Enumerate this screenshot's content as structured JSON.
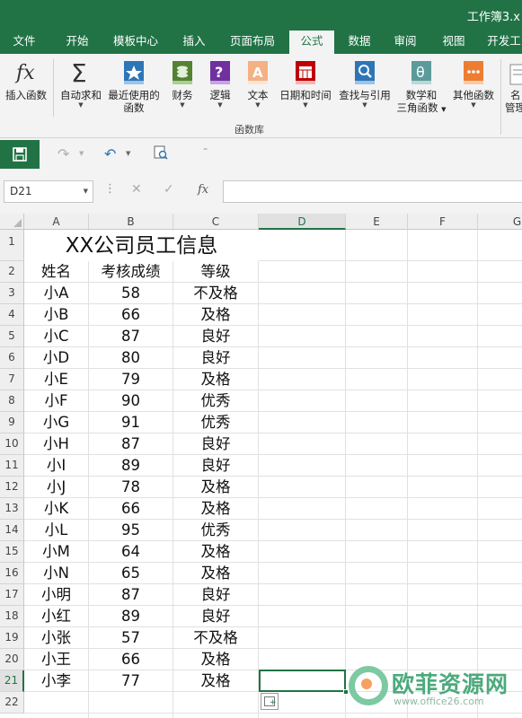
{
  "window": {
    "title": "工作簿3.x"
  },
  "tabs": [
    {
      "label": "文件"
    },
    {
      "label": "开始"
    },
    {
      "label": "模板中心"
    },
    {
      "label": "插入"
    },
    {
      "label": "页面布局"
    },
    {
      "label": "公式"
    },
    {
      "label": "数据"
    },
    {
      "label": "审阅"
    },
    {
      "label": "视图"
    },
    {
      "label": "开发工"
    }
  ],
  "active_tab": "公式",
  "ribbon": {
    "group_label": "函数库",
    "buttons": [
      {
        "line1": "插入函数",
        "line2": "",
        "icon": "fx-icon"
      },
      {
        "line1": "自动求和",
        "line2": "",
        "icon": "sigma-icon"
      },
      {
        "line1": "最近使用的",
        "line2": "函数",
        "icon": "star-book-icon"
      },
      {
        "line1": "财务",
        "line2": "",
        "icon": "coins-book-icon"
      },
      {
        "line1": "逻辑",
        "line2": "",
        "icon": "question-book-icon"
      },
      {
        "line1": "文本",
        "line2": "",
        "icon": "text-book-icon"
      },
      {
        "line1": "日期和时间",
        "line2": "",
        "icon": "calendar-book-icon"
      },
      {
        "line1": "查找与引用",
        "line2": "",
        "icon": "search-book-icon"
      },
      {
        "line1": "数学和",
        "line2": "三角函数",
        "icon": "theta-book-icon"
      },
      {
        "line1": "其他函数",
        "line2": "",
        "icon": "more-book-icon"
      },
      {
        "line1": "名",
        "line2": "管理",
        "icon": "name-manager-icon"
      }
    ]
  },
  "formula_bar": {
    "name_box": "D21",
    "fx_label": "fx",
    "value": ""
  },
  "grid": {
    "columns": [
      "A",
      "B",
      "C",
      "D",
      "E",
      "F",
      "G"
    ],
    "selected_column": "D",
    "selected_row": "21",
    "rows": [
      "1",
      "2",
      "3",
      "4",
      "5",
      "6",
      "7",
      "8",
      "9",
      "10",
      "11",
      "12",
      "13",
      "14",
      "15",
      "16",
      "17",
      "18",
      "19",
      "20",
      "21",
      "22"
    ]
  },
  "sheet": {
    "title": "XX公司员工信息",
    "headers": [
      "姓名",
      "考核成绩",
      "等级"
    ],
    "records": [
      [
        "小A",
        "58",
        "不及格"
      ],
      [
        "小B",
        "66",
        "及格"
      ],
      [
        "小C",
        "87",
        "良好"
      ],
      [
        "小D",
        "80",
        "良好"
      ],
      [
        "小E",
        "79",
        "及格"
      ],
      [
        "小F",
        "90",
        "优秀"
      ],
      [
        "小G",
        "91",
        "优秀"
      ],
      [
        "小H",
        "87",
        "良好"
      ],
      [
        "小I",
        "89",
        "良好"
      ],
      [
        "小J",
        "78",
        "及格"
      ],
      [
        "小K",
        "66",
        "及格"
      ],
      [
        "小L",
        "95",
        "优秀"
      ],
      [
        "小M",
        "64",
        "及格"
      ],
      [
        "小N",
        "65",
        "及格"
      ],
      [
        "小明",
        "87",
        "良好"
      ],
      [
        "小红",
        "89",
        "良好"
      ],
      [
        "小张",
        "57",
        "不及格"
      ],
      [
        "小王",
        "66",
        "及格"
      ],
      [
        "小李",
        "77",
        "及格"
      ]
    ]
  },
  "watermark": {
    "text": "欧菲资源网",
    "url": "www.office26.com"
  },
  "colors": {
    "accent": "#217346",
    "ribbon_bg": "#f3f3f3",
    "watermark": "#4caa7c"
  }
}
